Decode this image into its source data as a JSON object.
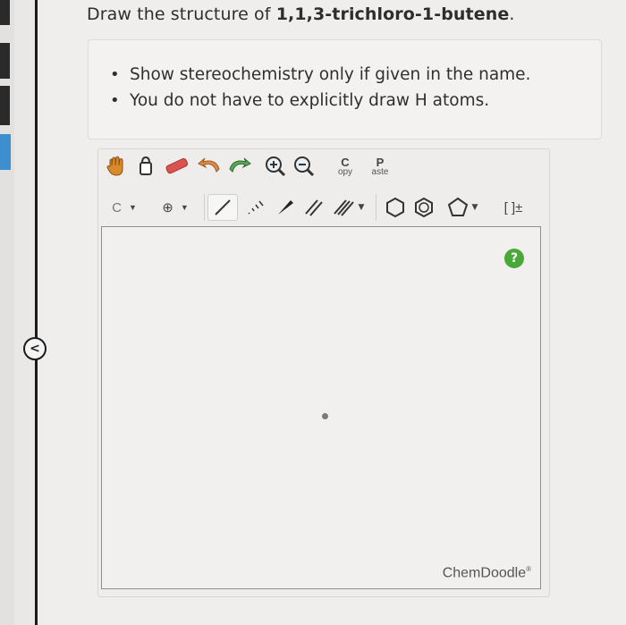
{
  "question": {
    "prefix": "Draw the structure of ",
    "compound": "1,1,3-trichloro-1-butene",
    "suffix": "."
  },
  "hints": [
    "Show stereochemistry only if given in the name.",
    "You do not have to explicitly draw H atoms."
  ],
  "toolbar": {
    "copy": {
      "letter": "C",
      "rest": "opy"
    },
    "paste": {
      "letter": "P",
      "rest": "aste"
    },
    "element_label": "C",
    "charge_label": "⊕",
    "brackets_label": "[ ]±"
  },
  "canvas": {
    "help_label": "?",
    "brand": "ChemDoodle",
    "brand_mark": "®"
  },
  "sidebar": {
    "collapse_label": "<"
  },
  "colors": {
    "help_green": "#4aa83a",
    "hand_orange": "#d98b2b",
    "eraser_red": "#d9534f",
    "redo_green": "#5aa85a",
    "undo_orange": "#e08a48",
    "sidebar_blue": "#3d8fd0"
  },
  "icons": [
    "hand-icon",
    "lasso-icon",
    "eraser-icon",
    "undo-icon",
    "redo-icon",
    "zoom-in-icon",
    "zoom-out-icon",
    "single-bond-icon",
    "dashed-bond-icon",
    "wedge-bond-icon",
    "double-bond-icon",
    "triple-bond-icon",
    "cyclohexane-icon",
    "benzene-icon",
    "cyclopentane-icon"
  ]
}
